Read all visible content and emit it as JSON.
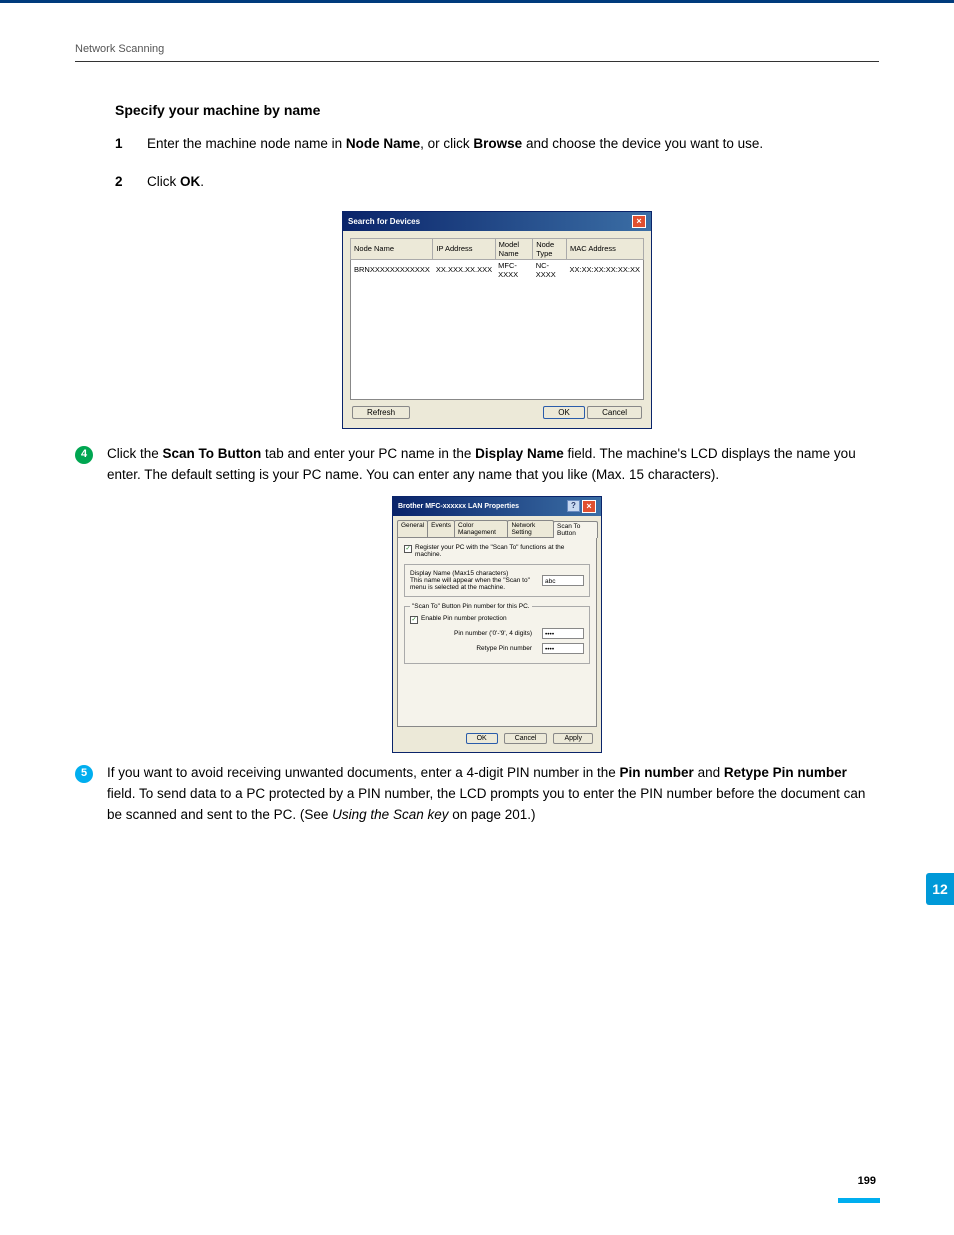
{
  "breadcrumb": "Network Scanning",
  "section_title": "Specify your machine by name",
  "steps": {
    "s1": {
      "num": "1",
      "pre": "Enter the machine node name in ",
      "bold1": "Node Name",
      "mid": ", or click ",
      "bold2": "Browse",
      "post": " and choose the device you want to use."
    },
    "s2": {
      "num": "2",
      "pre": "Click ",
      "bold1": "OK",
      "post": "."
    }
  },
  "bullet4": {
    "num": "4",
    "t1": "Click the ",
    "b1": "Scan To Button",
    "t2": " tab and enter your PC name in the ",
    "b2": "Display Name",
    "t3": " field. The machine's LCD displays the name you enter. The default setting is your PC name. You can enter any name that you like (Max. 15 characters)."
  },
  "bullet5": {
    "num": "5",
    "t1": "If you want to avoid receiving unwanted documents, enter a 4-digit PIN number in the ",
    "b1": "Pin number",
    "t2": " and ",
    "b2": "Retype Pin number",
    "t3": " field. To send data to a PC protected by a PIN number, the LCD prompts you to enter the PIN number before the document can be scanned and sent to the PC. (See ",
    "i1": "Using the Scan key",
    "t4": " on page 201.)"
  },
  "dialog1": {
    "title": "Search for Devices",
    "headers": [
      "Node Name",
      "IP Address",
      "Model Name",
      "Node Type",
      "MAC Address"
    ],
    "row": [
      "BRNXXXXXXXXXXXX",
      "XX.XXX.XX.XXX",
      "MFC-XXXX",
      "NC-XXXX",
      "XX:XX:XX:XX:XX:XX"
    ],
    "refresh": "Refresh",
    "ok": "OK",
    "cancel": "Cancel"
  },
  "dialog2": {
    "title": "Brother  MFC-xxxxxx   LAN Properties",
    "tabs": [
      "General",
      "Events",
      "Color Management",
      "Network Setting",
      "Scan To Button"
    ],
    "register_label": "Register your PC with the \"Scan To\" functions at the machine.",
    "display_name_group": "Display Name (Max15 characters)\nThis name will appear when the \"Scan to\" menu is selected at the machine.",
    "display_name_value": "abc",
    "pin_group_legend": "\"Scan To\" Button Pin number for this PC.",
    "enable_pin": "Enable Pin number protection",
    "pin_label": "Pin number ('0'-'9', 4 digits)",
    "retype_label": "Retype Pin number",
    "pin_value": "••••",
    "ok": "OK",
    "cancel": "Cancel",
    "apply": "Apply"
  },
  "side_tab": "12",
  "page_number": "199"
}
